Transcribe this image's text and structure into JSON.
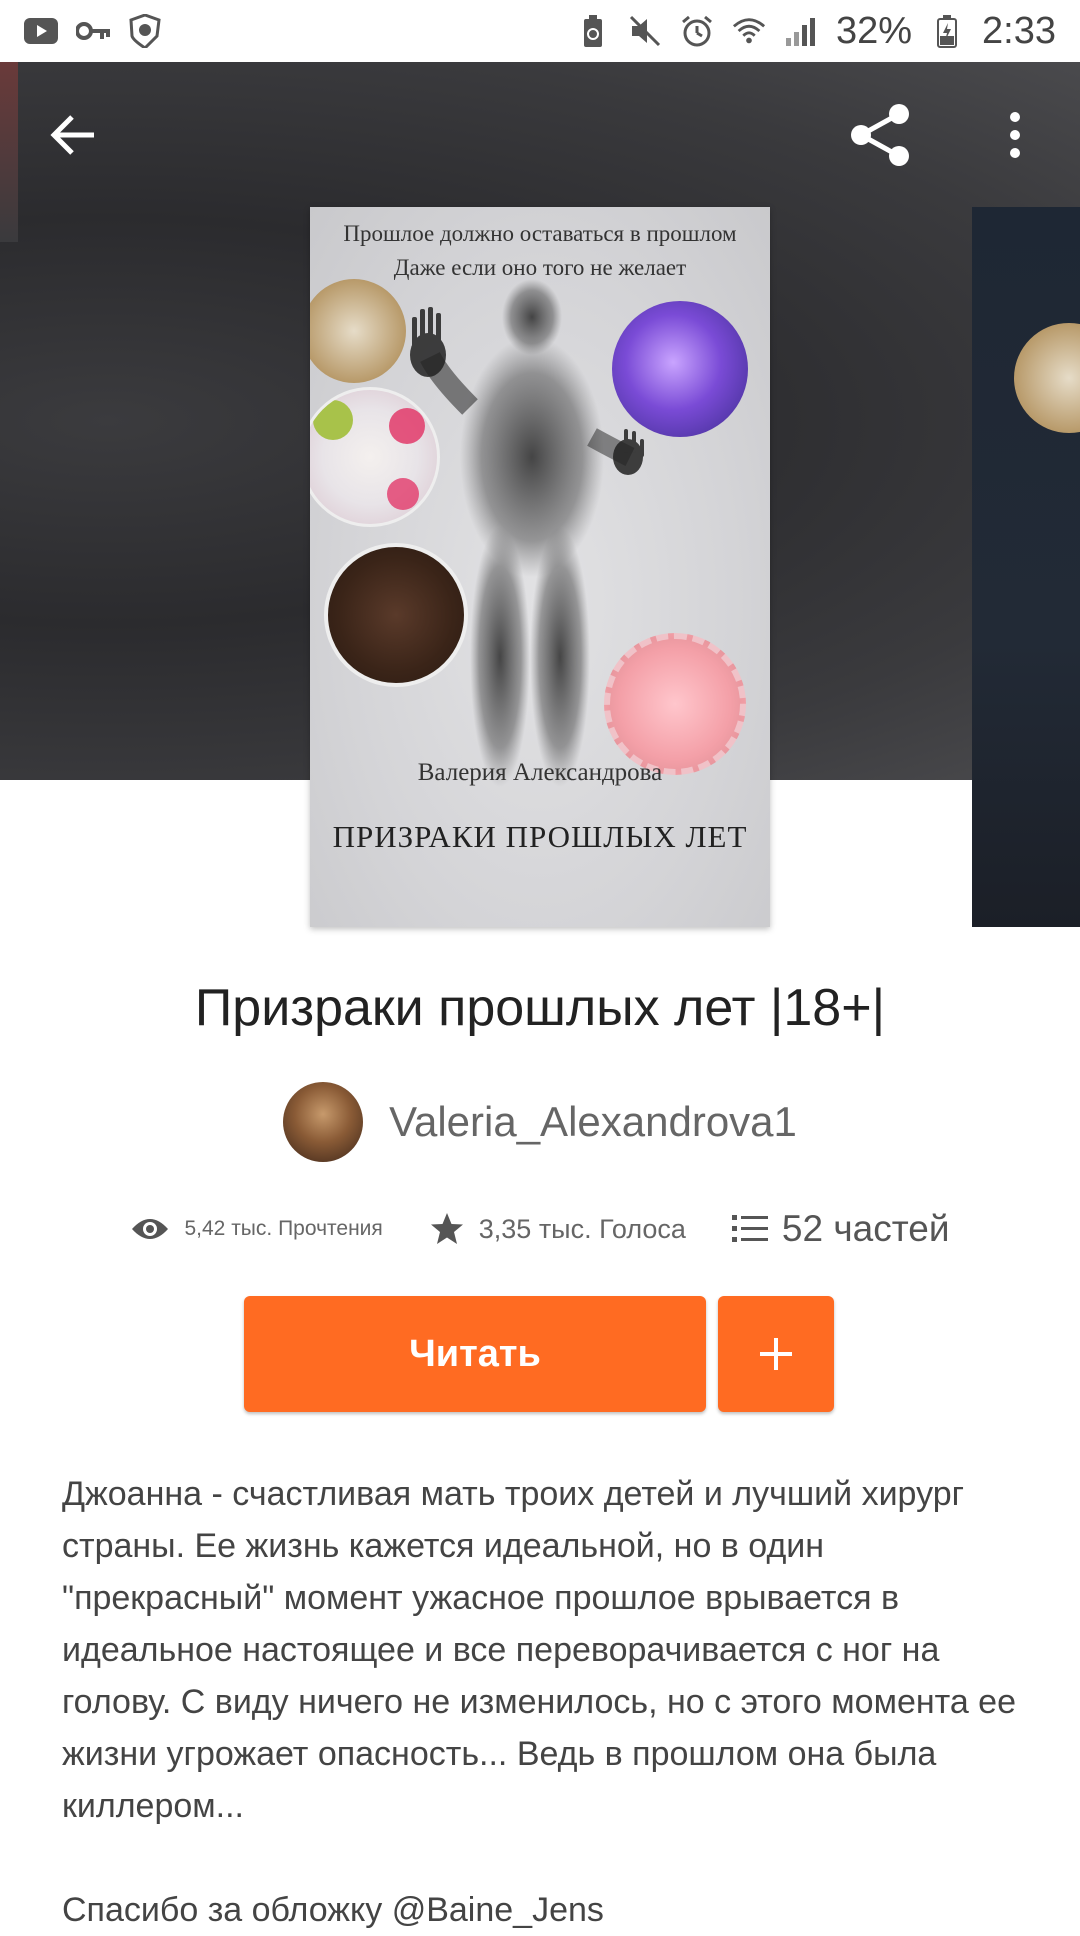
{
  "status_bar": {
    "left_icons": [
      "youtube-icon",
      "key-icon",
      "shield-icon"
    ],
    "right_icons": [
      "battery-saver-icon",
      "mute-icon",
      "alarm-icon",
      "wifi-icon",
      "signal-icon",
      "battery-icon"
    ],
    "battery": "32%",
    "time": "2:33"
  },
  "toolbar": {
    "back_icon": "arrow-left-icon",
    "share_icon": "share-icon",
    "more_icon": "more-vertical-icon"
  },
  "cover": {
    "line1": "Прошлое должно оставаться в прошлом",
    "line2": "Даже если оно того не желает",
    "author": "Валерия Александрова",
    "title": "ПРИЗРАКИ ПРОШЛЫХ ЛЕТ"
  },
  "book": {
    "title": "Призраки прошлых лет |18+|",
    "author": "Valeria_Alexandrova1"
  },
  "stats": {
    "reads": "5,42 тыс. Прочтения",
    "votes": "3,35 тыс. Голоса",
    "parts": "52 частей"
  },
  "actions": {
    "read_label": "Читать",
    "add_icon": "plus-icon"
  },
  "description": {
    "text": "Джоанна - счастливая мать троих детей и лучший хирург страны. Ее жизнь кажется идеальной, но в один \"прекрасный\" момент ужасное прошлое врывается в идеальное настоящее и все переворачивается с ног на голову. С виду ничего не изменилось, но с этого момента ее жизни угрожает опасность... Ведь в прошлом она была киллером...",
    "thanks": "Спасибо за обложку @Baine_Jens"
  },
  "colors": {
    "accent": "#ff6b22",
    "hero_bg": "#333336"
  }
}
